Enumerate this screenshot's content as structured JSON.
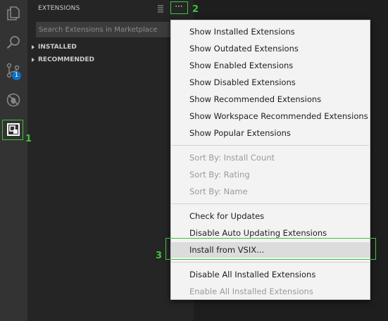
{
  "sidebar": {
    "title": "EXTENSIONS",
    "search_placeholder": "Search Extensions in Marketplace",
    "sections": [
      {
        "label": "INSTALLED"
      },
      {
        "label": "RECOMMENDED"
      }
    ]
  },
  "activity_bar": {
    "items": [
      {
        "icon": "explorer-icon"
      },
      {
        "icon": "search-icon"
      },
      {
        "icon": "source-control-icon",
        "badge": "1"
      },
      {
        "icon": "debug-icon"
      },
      {
        "icon": "extensions-icon"
      }
    ]
  },
  "toolbar": {
    "more_label": "···"
  },
  "menu": {
    "group1": [
      "Show Installed Extensions",
      "Show Outdated Extensions",
      "Show Enabled Extensions",
      "Show Disabled Extensions",
      "Show Recommended Extensions",
      "Show Workspace Recommended Extensions",
      "Show Popular Extensions"
    ],
    "group2": [
      "Sort By: Install Count",
      "Sort By: Rating",
      "Sort By: Name"
    ],
    "group3": [
      "Check for Updates",
      "Disable Auto Updating Extensions",
      "Install from VSIX..."
    ],
    "group4": [
      "Disable All Installed Extensions",
      "Enable All Installed Extensions"
    ]
  },
  "annotations": {
    "label1": "1",
    "label2": "2",
    "label3": "3",
    "color": "#3ec43e"
  }
}
